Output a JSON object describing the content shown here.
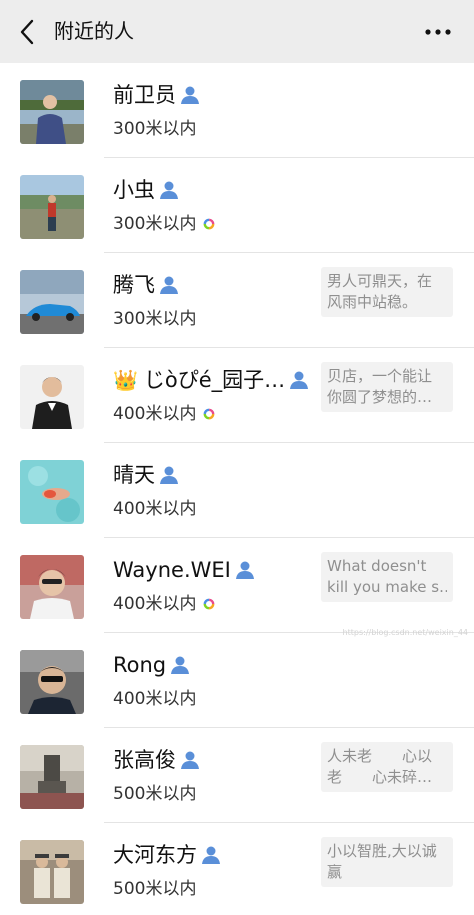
{
  "header": {
    "title": "附近的人",
    "back_icon": "chevron-left-icon",
    "more_icon": "ellipsis-icon"
  },
  "colors": {
    "nav_bg": "#ededed",
    "list_bg": "#ffffff",
    "person_icon": "#5a8fd8",
    "signature_bg": "#f2f2f2",
    "signature_text": "#8f8f8f"
  },
  "people": [
    {
      "name": "前卫员",
      "distance": "300米以内",
      "gender_icon": "person-icon",
      "moments_icon": false,
      "signature": [
        "",
        ""
      ]
    },
    {
      "name": "小虫",
      "distance": "300米以内",
      "gender_icon": "person-icon",
      "moments_icon": true,
      "signature": [
        "",
        ""
      ]
    },
    {
      "name": "腾飞",
      "distance": "300米以内",
      "gender_icon": "person-icon",
      "moments_icon": false,
      "signature": [
        "男人可鼎天，在",
        "风雨中站稳。"
      ]
    },
    {
      "name": "じòぴé_园子…",
      "crown": "👑",
      "distance": "400米以内",
      "gender_icon": "person-icon",
      "moments_icon": true,
      "signature": [
        "贝店，一个能让",
        "你圆了梦想的…"
      ]
    },
    {
      "name": "晴天",
      "distance": "400米以内",
      "gender_icon": "person-icon",
      "moments_icon": false,
      "signature": [
        "",
        ""
      ]
    },
    {
      "name": "Wayne.WEI",
      "distance": "400米以内",
      "gender_icon": "person-icon",
      "moments_icon": true,
      "signature": [
        "What doesn't",
        "kill you make s…"
      ]
    },
    {
      "name": "Rong",
      "distance": "400米以内",
      "gender_icon": "person-icon",
      "moments_icon": false,
      "signature": [
        "",
        ""
      ]
    },
    {
      "name": "张高俊",
      "distance": "500米以内",
      "gender_icon": "person-icon",
      "moments_icon": false,
      "signature": [
        "人未老　　心以",
        "老　　心未碎…"
      ]
    },
    {
      "name": "大河东方",
      "distance": "500米以内",
      "gender_icon": "person-icon",
      "moments_icon": false,
      "signature": [
        "小以智胜,大以诚",
        "赢"
      ]
    }
  ],
  "watermark": "https://blog.csdn.net/weixin_44"
}
